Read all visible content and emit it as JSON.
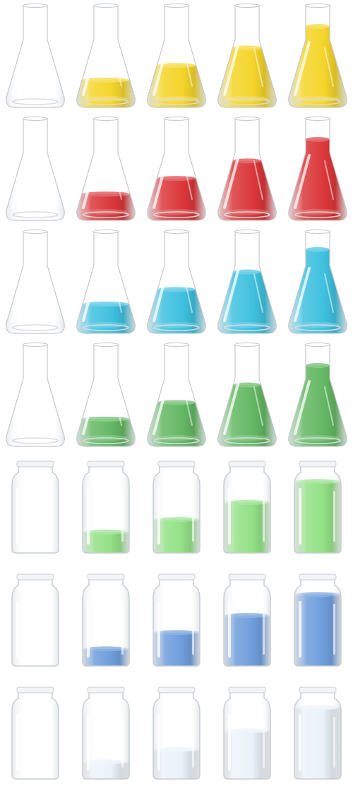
{
  "liquid_colors": {
    "yellow": "#f2cc00",
    "red": "#d40f12",
    "cyan": "#18b4d8",
    "green": "#44a944",
    "lime": "#6cd65a",
    "blue": "#3a7ad0",
    "milk": "#e4eef8",
    "glass_edge": "#c9cdd1"
  },
  "rows": [
    {
      "vessel": "flask",
      "color": "yellow",
      "levels": [
        0,
        0.28,
        0.43,
        0.61,
        0.83
      ]
    },
    {
      "vessel": "flask",
      "color": "red",
      "levels": [
        0,
        0.27,
        0.43,
        0.61,
        0.83
      ]
    },
    {
      "vessel": "flask",
      "color": "cyan",
      "levels": [
        0,
        0.3,
        0.45,
        0.63,
        0.86
      ]
    },
    {
      "vessel": "flask",
      "color": "green",
      "levels": [
        0,
        0.28,
        0.45,
        0.63,
        0.83
      ]
    },
    {
      "vessel": "bottle",
      "color": "lime",
      "levels": [
        0,
        0.27,
        0.43,
        0.65,
        0.92
      ]
    },
    {
      "vessel": "bottle",
      "color": "blue",
      "levels": [
        0,
        0.22,
        0.43,
        0.65,
        0.92
      ]
    },
    {
      "vessel": "bottle",
      "color": "milk",
      "levels": [
        0,
        0.22,
        0.38,
        0.62,
        0.92
      ]
    }
  ]
}
